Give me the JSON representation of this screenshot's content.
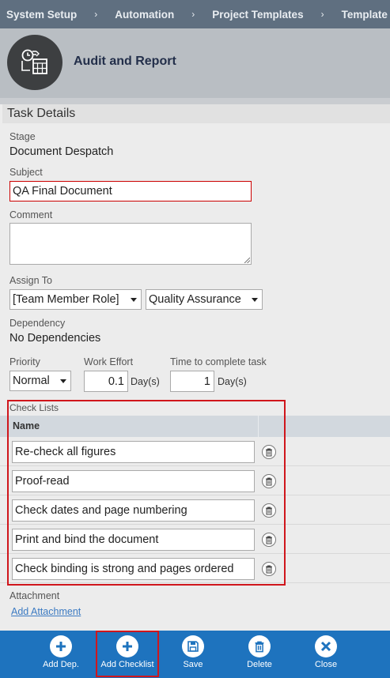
{
  "breadcrumb": {
    "items": [
      "System Setup",
      "Automation",
      "Project Templates",
      "Template Details"
    ],
    "separator": "›"
  },
  "header": {
    "title": "Audit and Report",
    "logo_icon": "template-calendar-icon"
  },
  "panel": {
    "title": "Task Details"
  },
  "form": {
    "stage_label": "Stage",
    "stage_value": "Document Despatch",
    "subject_label": "Subject",
    "subject_value": "QA Final Document",
    "comment_label": "Comment",
    "comment_value": "",
    "assign_label": "Assign To",
    "assign_role": "[Team Member Role]",
    "assign_team": "Quality Assurance",
    "dependency_label": "Dependency",
    "dependency_value": "No Dependencies",
    "priority_label": "Priority",
    "priority_value": "Normal",
    "effort_label": "Work Effort",
    "effort_value": "0.1",
    "effort_unit": "Day(s)",
    "time_label": "Time to complete task",
    "time_value": "1",
    "time_unit": "Day(s)"
  },
  "checklist": {
    "label": "Check Lists",
    "column_name": "Name",
    "items": [
      "Re-check all figures",
      "Proof-read",
      "Check dates and page numbering",
      "Print and bind the document",
      "Check binding is strong and pages ordered"
    ],
    "item_icon": "trash-icon"
  },
  "attachment": {
    "label": "Attachment",
    "link": "Add Attachment"
  },
  "toolbar": {
    "buttons": [
      {
        "label": "Add Dep.",
        "icon": "plus-icon"
      },
      {
        "label": "Add Checklist",
        "icon": "plus-icon"
      },
      {
        "label": "Save",
        "icon": "save-icon"
      },
      {
        "label": "Delete",
        "icon": "trash-icon"
      },
      {
        "label": "Close",
        "icon": "close-icon"
      }
    ]
  },
  "colors": {
    "breadcrumb_bg": "#5f6f80",
    "header_bg": "#b9bec3",
    "toolbar_bg": "#1e73be",
    "highlight": "#d0161c",
    "link": "#3b7ac2"
  }
}
